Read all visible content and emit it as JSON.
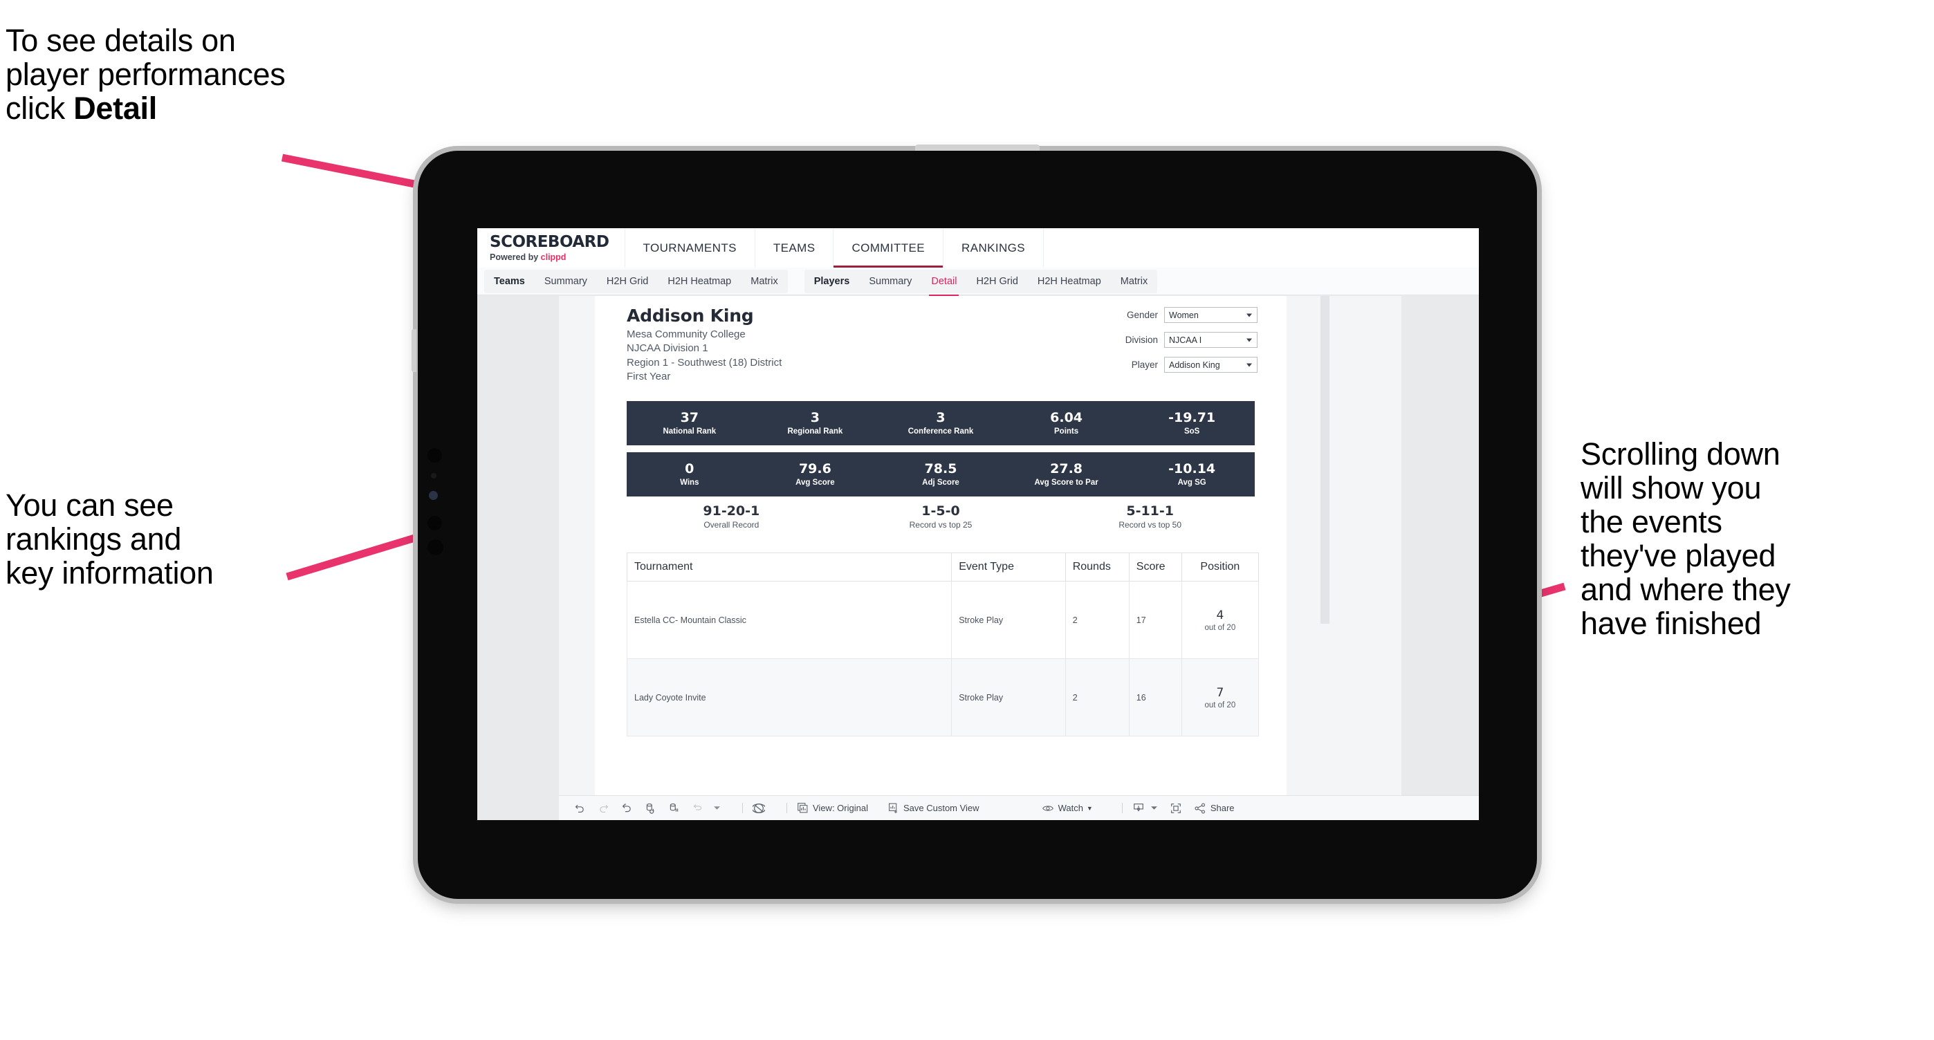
{
  "annotations": {
    "detail": "To see details on\nplayer performances\nclick ",
    "detail_bold": "Detail",
    "rankings": "You can see\nrankings and\nkey information",
    "scrolling": "Scrolling down\nwill show you\nthe events\nthey've played\nand where they\nhave finished",
    "arrow_color": "#e8336d"
  },
  "brand": {
    "title": "SCOREBOARD",
    "powered": "Powered by ",
    "powered_brand": "clippd"
  },
  "topnav": [
    {
      "label": "TOURNAMENTS",
      "active": false
    },
    {
      "label": "TEAMS",
      "active": false
    },
    {
      "label": "COMMITTEE",
      "active": true
    },
    {
      "label": "RANKINGS",
      "active": false
    }
  ],
  "subnav": {
    "teams_group": [
      {
        "label": "Teams",
        "head": true,
        "active": false
      },
      {
        "label": "Summary",
        "head": false,
        "active": false
      },
      {
        "label": "H2H Grid",
        "head": false,
        "active": false
      },
      {
        "label": "H2H Heatmap",
        "head": false,
        "active": false
      },
      {
        "label": "Matrix",
        "head": false,
        "active": false
      }
    ],
    "players_group": [
      {
        "label": "Players",
        "head": true,
        "active": false
      },
      {
        "label": "Summary",
        "head": false,
        "active": false
      },
      {
        "label": "Detail",
        "head": false,
        "active": true
      },
      {
        "label": "H2H Grid",
        "head": false,
        "active": false
      },
      {
        "label": "H2H Heatmap",
        "head": false,
        "active": false
      },
      {
        "label": "Matrix",
        "head": false,
        "active": false
      }
    ]
  },
  "player": {
    "name": "Addison King",
    "school": "Mesa Community College",
    "division": "NJCAA Division 1",
    "region": "Region 1 - Southwest (18) District",
    "year": "First Year"
  },
  "filters": [
    {
      "label": "Gender",
      "value": "Women"
    },
    {
      "label": "Division",
      "value": "NJCAA I"
    },
    {
      "label": "Player",
      "value": "Addison King"
    }
  ],
  "kpis_row1": [
    {
      "value": "37",
      "label": "National Rank"
    },
    {
      "value": "3",
      "label": "Regional Rank"
    },
    {
      "value": "3",
      "label": "Conference Rank"
    },
    {
      "value": "6.04",
      "label": "Points"
    },
    {
      "value": "-19.71",
      "label": "SoS"
    }
  ],
  "kpis_row2": [
    {
      "value": "0",
      "label": "Wins"
    },
    {
      "value": "79.6",
      "label": "Avg Score"
    },
    {
      "value": "78.5",
      "label": "Adj Score"
    },
    {
      "value": "27.8",
      "label": "Avg Score to Par"
    },
    {
      "value": "-10.14",
      "label": "Avg SG"
    }
  ],
  "records": [
    {
      "value": "91-20-1",
      "label": "Overall Record"
    },
    {
      "value": "1-5-0",
      "label": "Record vs top 25"
    },
    {
      "value": "5-11-1",
      "label": "Record vs top 50"
    }
  ],
  "table": {
    "headers": [
      "Tournament",
      "Event Type",
      "Rounds",
      "Score",
      "Position"
    ],
    "rows": [
      {
        "tournament": "Estella CC- Mountain Classic",
        "event_type": "Stroke Play",
        "rounds": "2",
        "score": "17",
        "position": "4",
        "position_of": "out of 20"
      },
      {
        "tournament": "Lady Coyote Invite",
        "event_type": "Stroke Play",
        "rounds": "2",
        "score": "16",
        "position": "7",
        "position_of": "out of 20"
      }
    ]
  },
  "toolbar": {
    "view_label": "View: Original",
    "save_label": "Save Custom View",
    "watch_label": "Watch",
    "share_label": "Share"
  }
}
